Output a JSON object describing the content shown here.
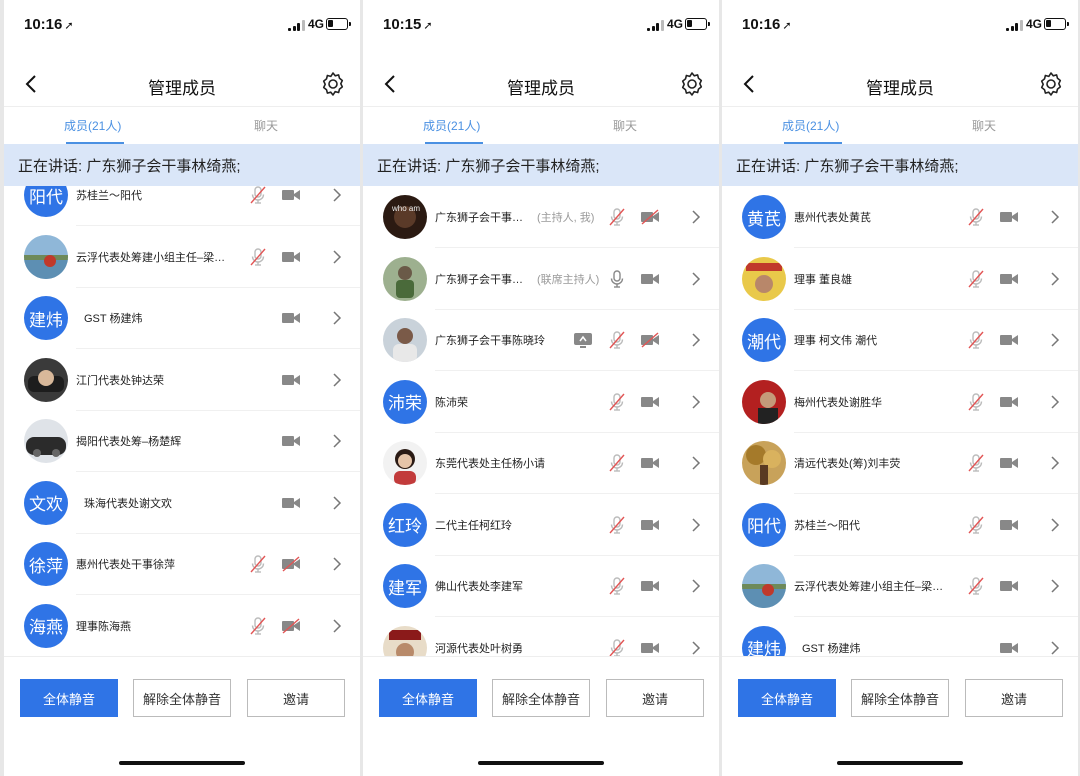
{
  "colors": {
    "accent": "#2f74e6",
    "banner_bg": "#dae6f8",
    "muted_icon": "#bbbbbb",
    "tab_active": "#4a90e2"
  },
  "phones": [
    {
      "time": "10:16",
      "network": "4G",
      "title": "管理成员",
      "tabs": {
        "members": "成员(21人)",
        "chat": "聊天"
      },
      "speaking": "正在讲话: 广东狮子会干事林绮燕;",
      "buttons": {
        "mute_all": "全体静音",
        "unmute_all": "解除全体静音",
        "invite": "邀请"
      },
      "members": [
        {
          "name": "苏桂兰～阳代",
          "avatar_text": "阳代",
          "avatar": "text",
          "mic": "muted",
          "video": "on",
          "screen": false
        },
        {
          "name": "云浮代表处筹建小组主任–梁…",
          "avatar": "photo-lake",
          "mic": "muted",
          "video": "on",
          "screen": false
        },
        {
          "name": "GST 杨建炜",
          "avatar_text": "建炜",
          "avatar": "text",
          "mic": "none",
          "video": "on",
          "screen": false
        },
        {
          "name": "江门代表处钟达荣",
          "avatar": "photo-car",
          "mic": "none",
          "video": "on",
          "screen": false
        },
        {
          "name": "揭阳代表处筹–杨楚辉",
          "avatar": "photo-car2",
          "mic": "none",
          "video": "on",
          "screen": false
        },
        {
          "name": "珠海代表处谢文欢",
          "avatar_text": "文欢",
          "avatar": "text",
          "mic": "none",
          "video": "on",
          "screen": false
        },
        {
          "name": "惠州代表处干事徐萍",
          "avatar_text": "徐萍",
          "avatar": "text",
          "mic": "muted",
          "video": "off",
          "screen": false
        },
        {
          "name": "理事陈海燕",
          "avatar_text": "海燕",
          "avatar": "text",
          "mic": "muted",
          "video": "off",
          "screen": false
        }
      ]
    },
    {
      "time": "10:15",
      "network": "4G",
      "title": "管理成员",
      "tabs": {
        "members": "成员(21人)",
        "chat": "聊天"
      },
      "speaking": "正在讲话: 广东狮子会干事林绮燕;",
      "buttons": {
        "mute_all": "全体静音",
        "unmute_all": "解除全体静音",
        "invite": "邀请"
      },
      "members": [
        {
          "name": "广东狮子会干事…",
          "role": "(主持人, 我)",
          "avatar": "photo-dark",
          "mic": "muted",
          "video": "off",
          "screen": false
        },
        {
          "name": "广东狮子会干事…",
          "role": "(联席主持人)",
          "avatar": "photo-green",
          "mic": "on",
          "video": "on",
          "screen": false
        },
        {
          "name": "广东狮子会干事陈晓玲",
          "avatar": "photo-person",
          "mic": "muted",
          "video": "off",
          "screen": true
        },
        {
          "name": "陈沛荣",
          "avatar_text": "沛荣",
          "avatar": "text",
          "mic": "muted",
          "video": "on",
          "screen": false
        },
        {
          "name": "东莞代表处主任杨小请",
          "avatar": "photo-woman",
          "mic": "muted",
          "video": "on",
          "screen": false
        },
        {
          "name": "二代主任柯红玲",
          "avatar_text": "红玲",
          "avatar": "text",
          "mic": "muted",
          "video": "on",
          "screen": false
        },
        {
          "name": "佛山代表处李建军",
          "avatar_text": "建军",
          "avatar": "text",
          "mic": "muted",
          "video": "on",
          "screen": false
        },
        {
          "name": "河源代表处叶树勇",
          "avatar": "photo-man",
          "mic": "muted",
          "video": "on",
          "screen": false
        }
      ]
    },
    {
      "time": "10:16",
      "network": "4G",
      "title": "管理成员",
      "tabs": {
        "members": "成员(21人)",
        "chat": "聊天"
      },
      "speaking": "正在讲话: 广东狮子会干事林绮燕;",
      "buttons": {
        "mute_all": "全体静音",
        "unmute_all": "解除全体静音",
        "invite": "邀请"
      },
      "members": [
        {
          "name": "惠州代表处黄芪",
          "avatar_text": "黄芪",
          "avatar": "text",
          "mic": "muted",
          "video": "on",
          "screen": false
        },
        {
          "name": "理事 董良雄",
          "avatar": "photo-yellow",
          "mic": "muted",
          "video": "on",
          "screen": false
        },
        {
          "name": "理事 柯文伟 潮代",
          "avatar_text": "潮代",
          "avatar": "text",
          "mic": "muted",
          "video": "on",
          "screen": false
        },
        {
          "name": "梅州代表处谢胜华",
          "avatar": "photo-red",
          "mic": "muted",
          "video": "on",
          "screen": false
        },
        {
          "name": "清远代表处(筹)刘丰荧",
          "avatar": "photo-tree",
          "mic": "muted",
          "video": "on",
          "screen": false
        },
        {
          "name": "苏桂兰～阳代",
          "avatar_text": "阳代",
          "avatar": "text",
          "mic": "muted",
          "video": "on",
          "screen": false
        },
        {
          "name": "云浮代表处筹建小组主任–梁…",
          "avatar": "photo-lake",
          "mic": "muted",
          "video": "on",
          "screen": false
        },
        {
          "name": "GST 杨建炜",
          "avatar_text": "建炜",
          "avatar": "text",
          "mic": "none",
          "video": "on",
          "screen": false
        }
      ]
    }
  ]
}
